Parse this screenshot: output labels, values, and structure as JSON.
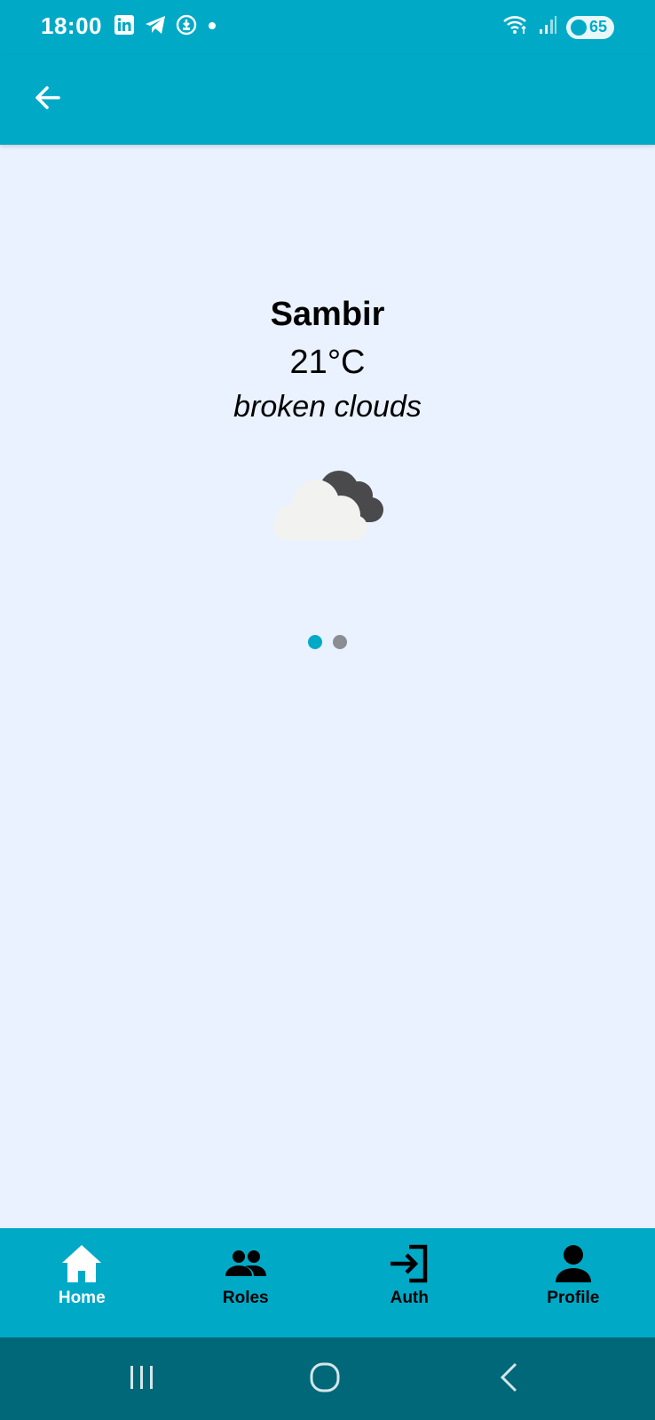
{
  "status_bar": {
    "time": "18:00",
    "battery": "65",
    "icons": [
      "linkedin-icon",
      "telegram-icon",
      "vpn-icon",
      "notification-dot-icon",
      "wifi-icon",
      "signal-icon",
      "battery-icon"
    ]
  },
  "app_bar": {
    "back_icon": "arrow-left-icon"
  },
  "weather": {
    "city": "Sambir",
    "temperature": "21°C",
    "description": "broken clouds",
    "icon": "broken-clouds-icon"
  },
  "pager": {
    "page_count": 2,
    "active_index": 0
  },
  "bottom_nav": {
    "items": [
      {
        "label": "Home",
        "icon": "home-icon",
        "active": true
      },
      {
        "label": "Roles",
        "icon": "people-icon",
        "active": false
      },
      {
        "label": "Auth",
        "icon": "login-icon",
        "active": false
      },
      {
        "label": "Profile",
        "icon": "person-icon",
        "active": false
      }
    ]
  },
  "system_nav": {
    "icons": [
      "recents-icon",
      "home-circle-icon",
      "back-chevron-icon"
    ]
  },
  "colors": {
    "primary": "#00aac7",
    "background": "#eaf2ff",
    "system_nav": "#006878",
    "dot_active": "#00aac7",
    "dot_inactive": "#8a8d93"
  }
}
